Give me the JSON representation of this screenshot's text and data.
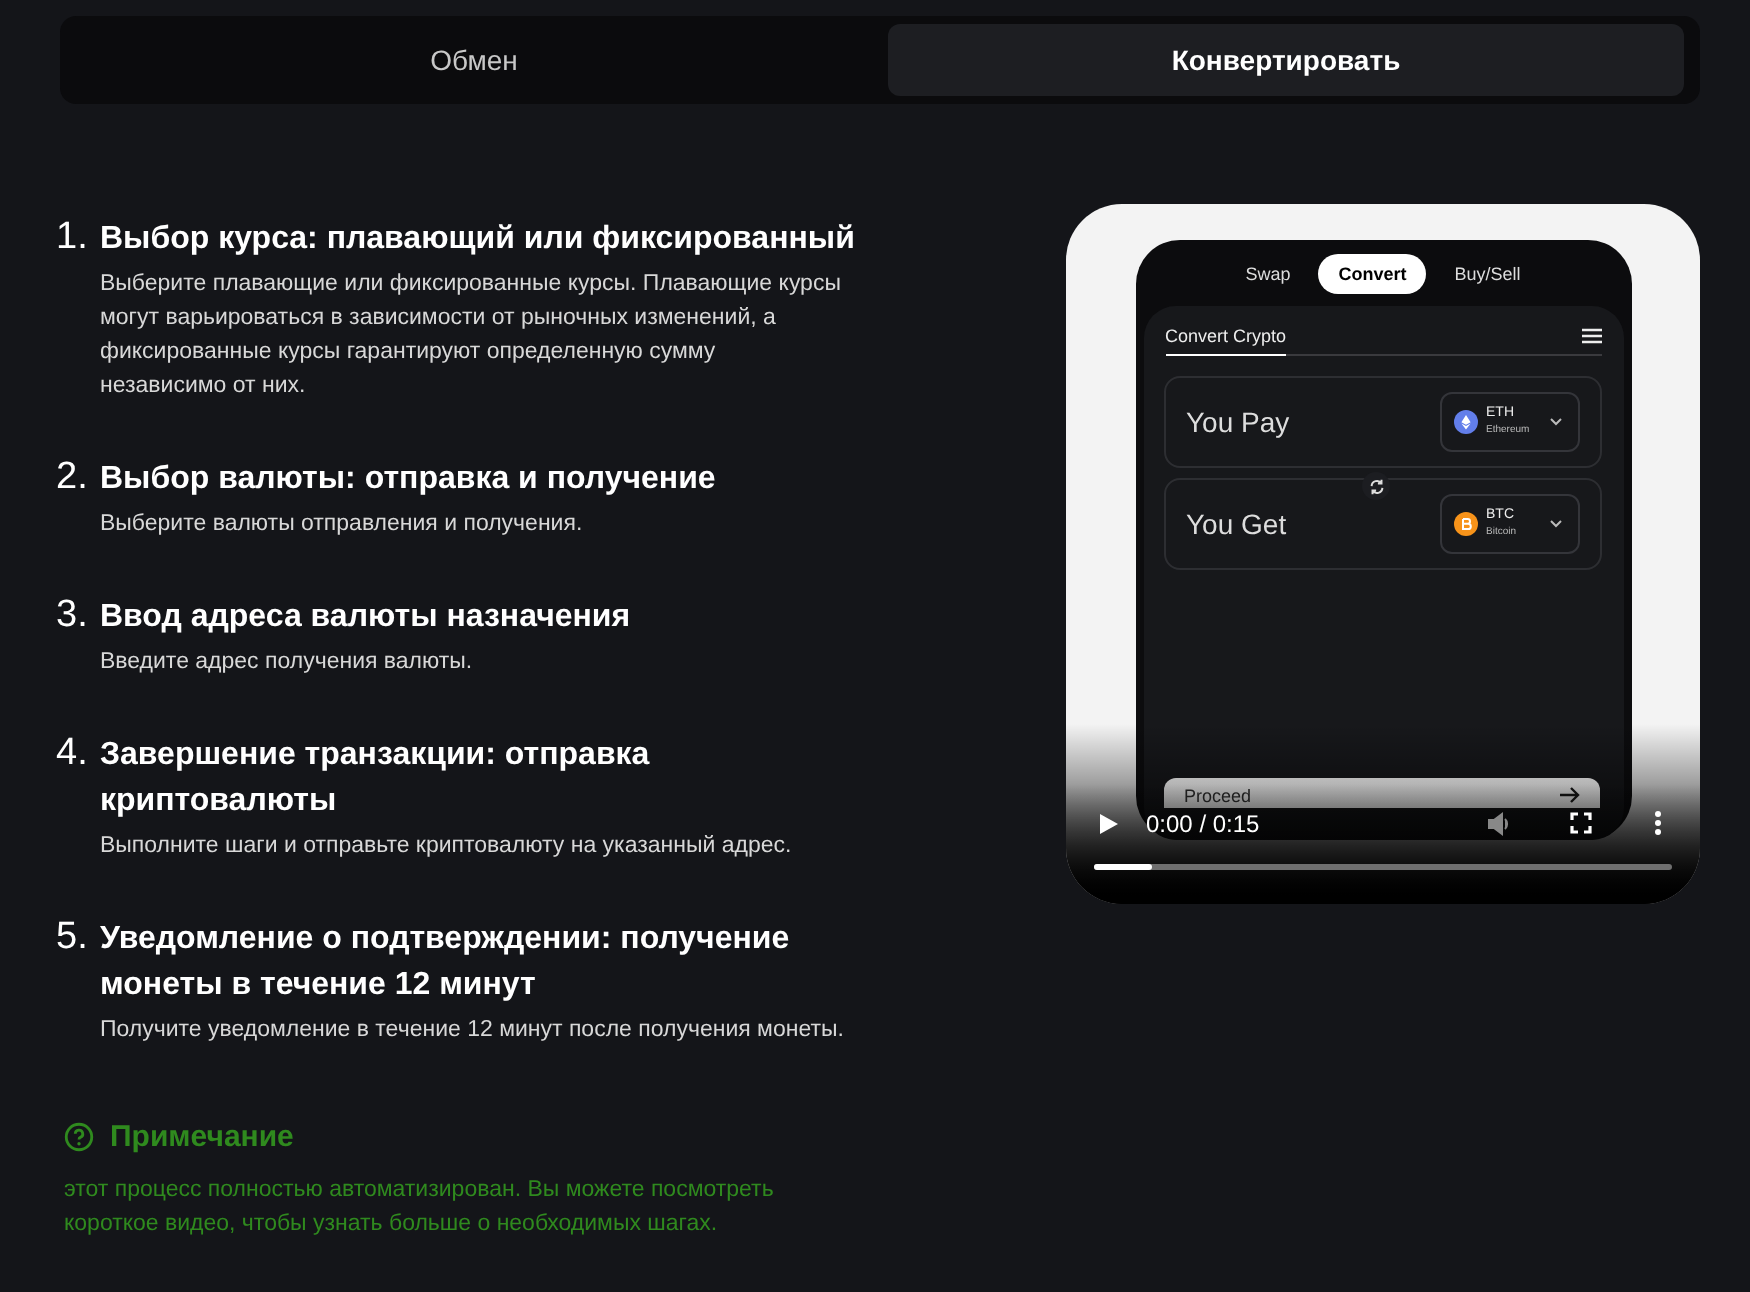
{
  "tabs": [
    {
      "label": "Обмен",
      "selected": false
    },
    {
      "label": "Конвертировать",
      "selected": true
    }
  ],
  "steps": [
    {
      "number": "1.",
      "title": "Выбор курса: плавающий или фиксированный",
      "text": "Выберите плавающие или фиксированные курсы. Плавающие курсы могут варьироваться в зависимости от рыночных изменений, а фиксированные курсы гарантируют определенную сумму независимо от них."
    },
    {
      "number": "2.",
      "title": "Выбор валюты: отправка и получение",
      "text": "Выберите валюты отправления и получения."
    },
    {
      "number": "3.",
      "title": "Ввод адреса валюты назначения",
      "text": "Введите адрес получения валюты."
    },
    {
      "number": "4.",
      "title": "Завершение транзакции: отправка криптовалюты",
      "text": "Выполните шаги и отправьте криптовалюту на указанный адрес."
    },
    {
      "number": "5.",
      "title": "Уведомление о подтверждении: получение монеты в течение 12 минут",
      "text": "Получите уведомление в течение 12 минут после получения монеты."
    }
  ],
  "note": {
    "title": "Примечание",
    "text": "этот процесс полностью автоматизирован. Вы можете посмотреть короткое видео, чтобы узнать больше о необходимых шагах."
  },
  "video": {
    "app_tabs": [
      {
        "label": "Swap",
        "selected": false
      },
      {
        "label": "Convert",
        "selected": true
      },
      {
        "label": "Buy/Sell",
        "selected": false
      }
    ],
    "panel_title": "Convert Crypto",
    "rows": [
      {
        "label": "You Pay",
        "symbol": "ETH",
        "name": "Ethereum",
        "kind": "eth",
        "color": "#627eea"
      },
      {
        "label": "You Get",
        "symbol": "BTC",
        "name": "Bitcoin",
        "kind": "btc",
        "color": "#f7931a"
      }
    ],
    "button": "Proceed",
    "time": "0:00 / 0:15",
    "progress": {
      "level": 0.1
    }
  }
}
